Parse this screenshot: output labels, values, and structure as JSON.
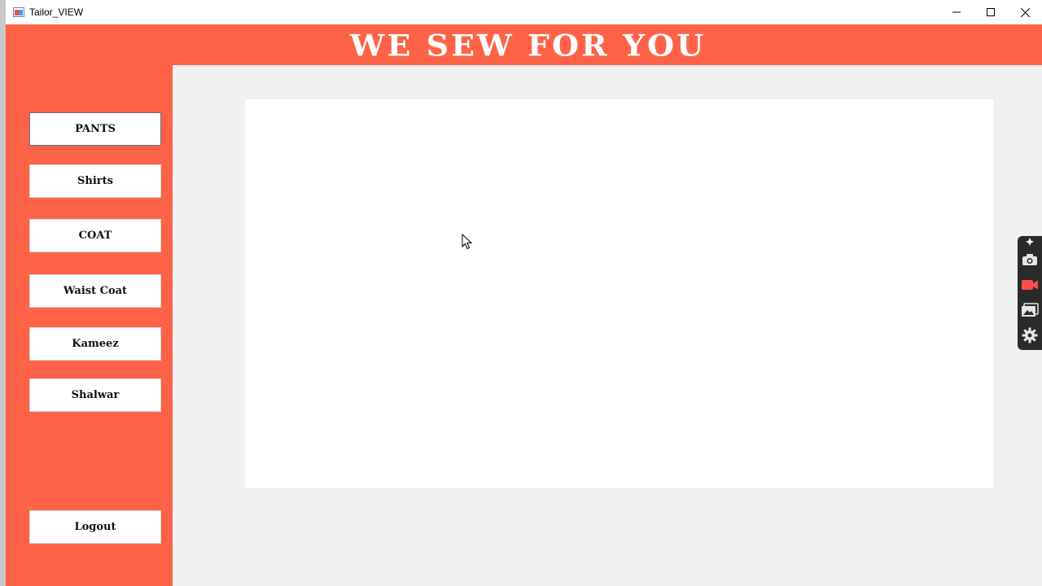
{
  "window": {
    "title": "Tailor_VIEW",
    "controls": {
      "minimize": "minimize-icon",
      "maximize": "maximize-icon",
      "close": "close-icon"
    }
  },
  "header": {
    "title": "WE SEW FOR YOU",
    "background": "#ff6347"
  },
  "sidebar": {
    "background": "#ff6347",
    "items": [
      {
        "label": "PANTS"
      },
      {
        "label": "Shirts"
      },
      {
        "label": "COAT"
      },
      {
        "label": "Waist Coat"
      },
      {
        "label": "Kameez"
      },
      {
        "label": "Shalwar"
      }
    ],
    "logout_label": "Logout"
  },
  "capture_toolbar": {
    "items": [
      "pin-icon",
      "camera-icon",
      "video-record-icon",
      "gallery-icon",
      "settings-gear-icon"
    ]
  }
}
